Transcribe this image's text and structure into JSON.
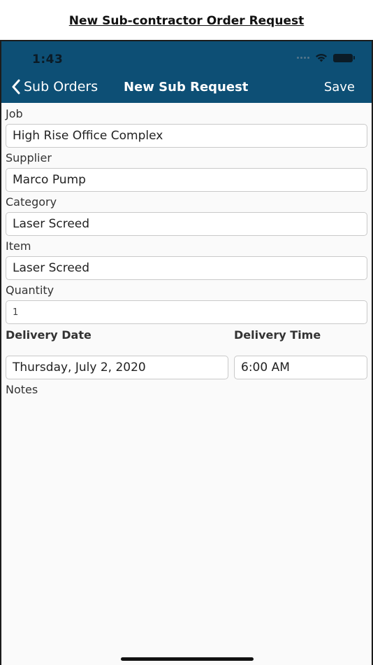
{
  "document": {
    "title": "New Sub-contractor Order Request"
  },
  "status_bar": {
    "time": "1:43"
  },
  "nav": {
    "back_label": "Sub Orders",
    "title": "New Sub Request",
    "save_label": "Save"
  },
  "form": {
    "job": {
      "label": "Job",
      "value": "High Rise Office Complex"
    },
    "supplier": {
      "label": "Supplier",
      "value": "Marco Pump"
    },
    "category": {
      "label": "Category",
      "value": "Laser Screed"
    },
    "item": {
      "label": "Item",
      "value": "Laser Screed"
    },
    "quantity": {
      "label": "Quantity",
      "value": "1"
    },
    "delivery_date": {
      "label": "Delivery Date",
      "value": "Thursday, July 2, 2020"
    },
    "delivery_time": {
      "label": "Delivery Time",
      "value": "6:00 AM"
    },
    "notes": {
      "label": "Notes"
    }
  },
  "colors": {
    "nav_bar": "#0d4f75",
    "background": "#fafafa"
  }
}
